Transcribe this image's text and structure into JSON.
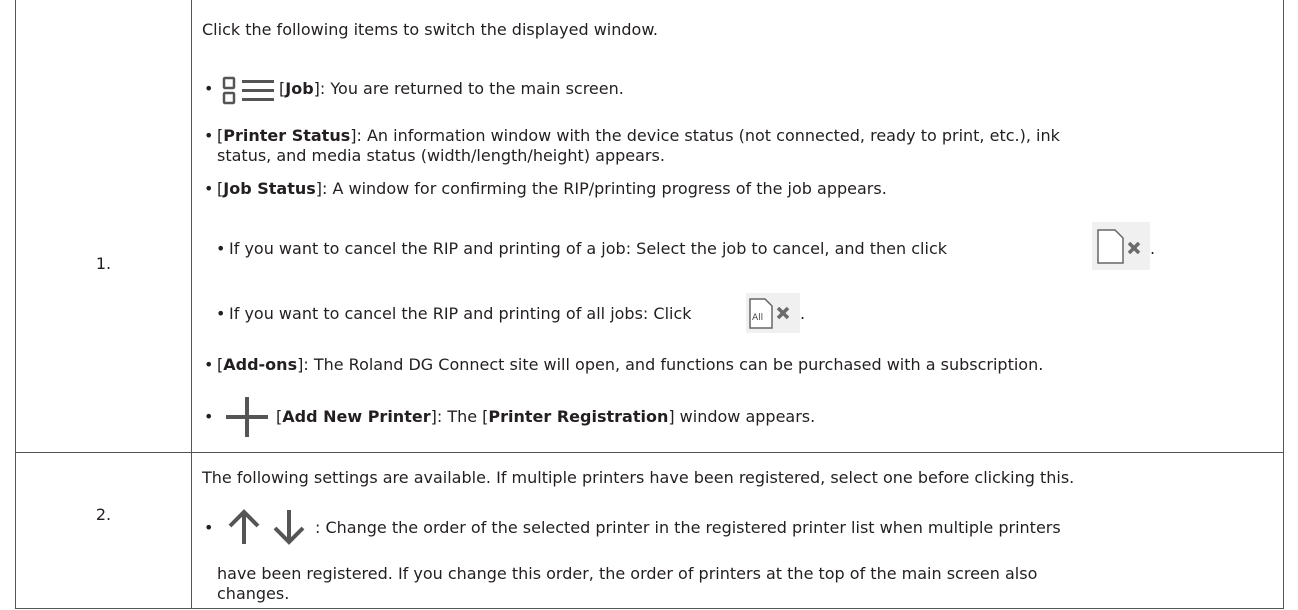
{
  "row1": {
    "number": "1.",
    "intro": "Click the following items to switch the displayed window.",
    "job": {
      "label": "Job",
      "text": ": You are returned to the main screen."
    },
    "printer_status": {
      "label": "Printer Status",
      "text_line1": ": An information window with the device status (not connected, ready to print, etc.), ink",
      "text_line2": "status, and media status (width/length/height) appears."
    },
    "job_status": {
      "label": "Job Status",
      "text": ": A window for confirming the RIP/printing progress of the job appears."
    },
    "cancel_one": "If you want to cancel the RIP and printing of a job: Select the job to cancel, and then click",
    "cancel_all": "If you want to cancel the RIP and printing of all jobs: Click",
    "all_icon_text": "All",
    "addons": {
      "label": "Add-ons",
      "text": ": The Roland DG Connect site will open, and functions can be purchased with a subscription."
    },
    "add_printer": {
      "label": "Add New Printer",
      "text_mid": ": The [",
      "label2": "Printer Registration",
      "text_end": "] window appears."
    }
  },
  "row2": {
    "number": "2.",
    "intro": "The following settings are available. If multiple printers have been registered, select one before clicking this.",
    "order_text_line1": ": Change the order of the selected printer in the registered printer list when multiple printers",
    "order_text_line2": "have been registered. If you change this order, the order of printers at the top of the main screen also",
    "order_text_line3": "changes."
  },
  "icons": [
    "job-list-icon",
    "cancel-job-icon",
    "cancel-all-jobs-icon",
    "add-printer-icon",
    "move-up-icon",
    "move-down-icon"
  ]
}
